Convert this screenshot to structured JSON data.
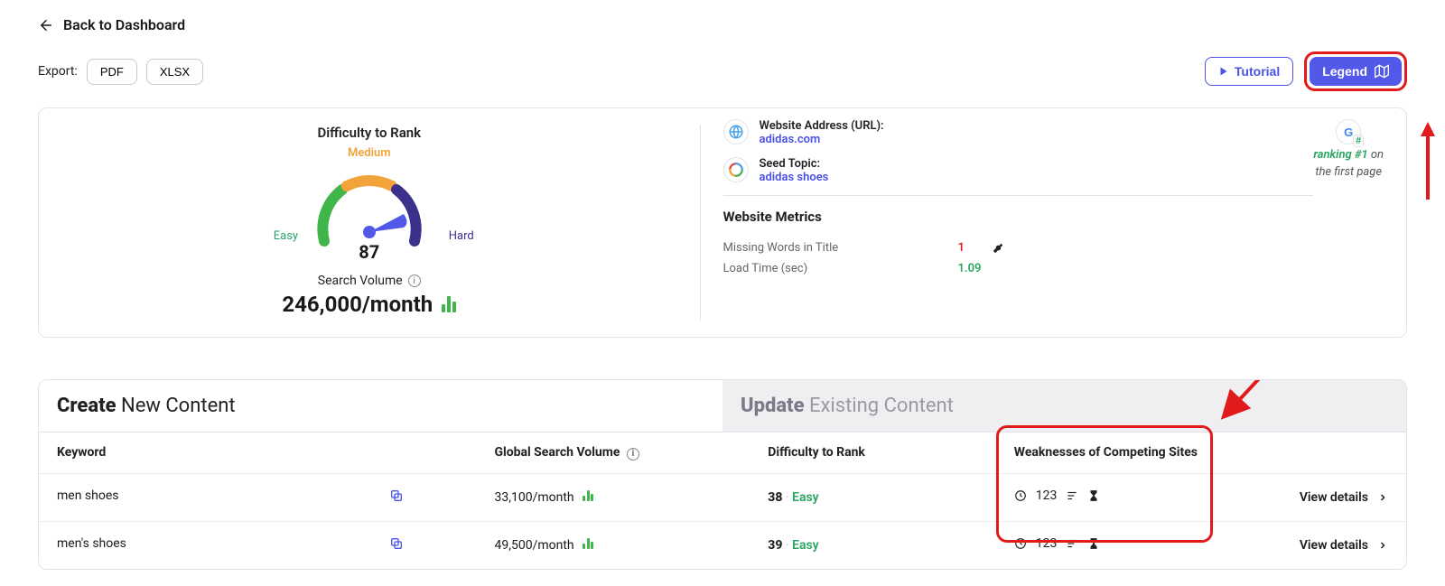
{
  "nav": {
    "back_label": "Back to Dashboard"
  },
  "export": {
    "label": "Export:",
    "pdf": "PDF",
    "xlsx": "XLSX"
  },
  "actions": {
    "tutorial": "Tutorial",
    "legend": "Legend"
  },
  "summary": {
    "difficulty_title": "Difficulty to Rank",
    "easy_label": "Easy",
    "medium_label": "Medium",
    "hard_label": "Hard",
    "score": "87",
    "search_volume_label": "Search Volume",
    "volume_value": "246,000/month",
    "url_label": "Website Address (URL):",
    "url_value": "adidas.com",
    "topic_label": "Seed Topic:",
    "topic_value": "adidas shoes",
    "ranking_text_1": "ranking #1",
    "ranking_text_2": "on",
    "ranking_text_3": "the first page",
    "metrics_title": "Website Metrics",
    "metric1_key": "Missing Words in Title",
    "metric1_val": "1",
    "metric2_key": "Load Time (sec)",
    "metric2_val": "1.09"
  },
  "tabs": {
    "create_strong": "Create",
    "create_light": "New Content",
    "update_strong": "Update",
    "update_light": "Existing Content"
  },
  "table": {
    "headers": {
      "keyword": "Keyword",
      "volume": "Global Search Volume",
      "difficulty": "Difficulty to Rank",
      "weaknesses": "Weaknesses of Competing Sites",
      "details": "View details"
    },
    "rows": [
      {
        "keyword": "men shoes",
        "volume": "33,100/month",
        "diff_num": "38",
        "diff_label": "Easy",
        "weak_num": "123"
      },
      {
        "keyword": "men's shoes",
        "volume": "49,500/month",
        "diff_num": "39",
        "diff_label": "Easy",
        "weak_num": "123"
      }
    ]
  }
}
